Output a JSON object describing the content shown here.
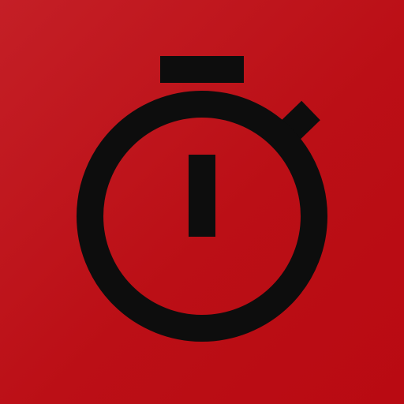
{
  "app_icon": {
    "icon": "stopwatch-icon",
    "colors": {
      "background_start": "#c41f26",
      "background_end": "#b90a12",
      "glyph": "#0d0d0d"
    }
  }
}
